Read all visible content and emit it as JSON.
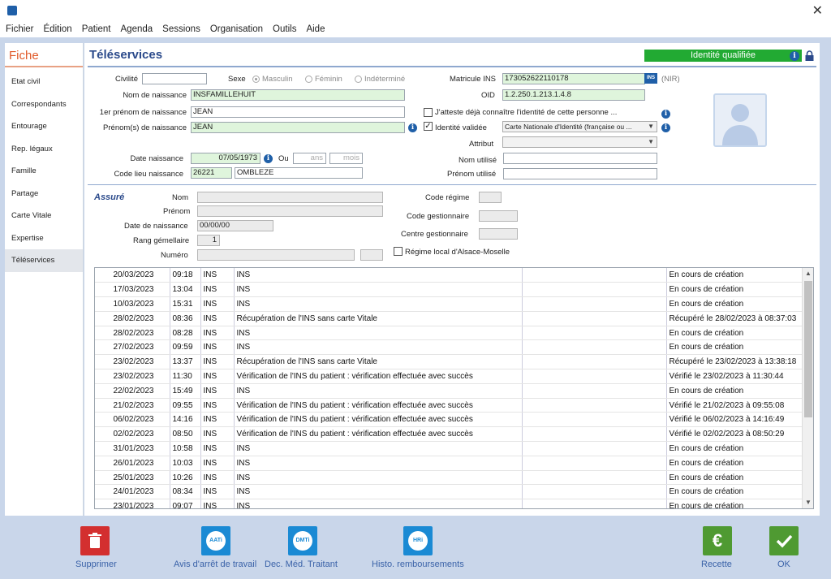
{
  "menu": [
    "Fichier",
    "Édition",
    "Patient",
    "Agenda",
    "Sessions",
    "Organisation",
    "Outils",
    "Aide"
  ],
  "sidebar": {
    "title": "Fiche",
    "items": [
      "Etat civil",
      "Correspondants",
      "Entourage",
      "Rep. légaux",
      "Famille",
      "Partage",
      "Carte Vitale",
      "Expertise",
      "Téléservices"
    ]
  },
  "header": {
    "title": "Téléservices",
    "badge": "Identité qualifiée",
    "info": "i"
  },
  "form": {
    "civilite_label": "Civilité",
    "sexe_label": "Sexe",
    "sexe_options": [
      "Masculin",
      "Féminin",
      "Indéterminé"
    ],
    "matricule_label": "Matricule INS",
    "matricule_value": "173052622110178",
    "ins_tag": "INS",
    "nir": "(NIR)",
    "nom_naissance_label": "Nom de naissance",
    "nom_naissance_value": "INSFAMILLEHUIT",
    "oid_label": "OID",
    "oid_value": "1.2.250.1.213.1.4.8",
    "premier_prenom_label": "1er prénom de naissance",
    "premier_prenom_value": "JEAN",
    "atteste_label": "J'atteste déjà connaître l'identité de cette personne ...",
    "prenoms_label": "Prénom(s) de naissance",
    "prenoms_value": "JEAN",
    "identite_validee_label": "Identité validée",
    "identite_doc": "Carte Nationale d'Identité (française ou ...",
    "attribut_label": "Attribut",
    "date_naissance_label": "Date naissance",
    "date_naissance_value": "07/05/1973",
    "ou": "Ou",
    "ans": "ans",
    "mois": "mois",
    "nom_utilise_label": "Nom utilisé",
    "code_lieu_label": "Code lieu naissance",
    "code_lieu_value": "26221",
    "commune_value": "OMBLEZE",
    "prenom_utilise_label": "Prénom utilisé"
  },
  "assure": {
    "title": "Assuré",
    "nom_label": "Nom",
    "prenom_label": "Prénom",
    "date_label": "Date de naissance",
    "date_value": "00/00/00",
    "rang_label": "Rang gémellaire",
    "rang_value": "1",
    "numero_label": "Numéro",
    "code_regime_label": "Code régime",
    "code_gestionnaire_label": "Code gestionnaire",
    "centre_gestionnaire_label": "Centre gestionnaire",
    "regime_local_label": "Régime local d'Alsace-Moselle"
  },
  "history": [
    [
      "20/03/2023",
      "09:18",
      "INS",
      "INS",
      "",
      "En cours de création"
    ],
    [
      "17/03/2023",
      "13:04",
      "INS",
      "INS",
      "",
      "En cours de création"
    ],
    [
      "10/03/2023",
      "15:31",
      "INS",
      "INS",
      "",
      "En cours de création"
    ],
    [
      "28/02/2023",
      "08:36",
      "INS",
      "Récupération de l'INS sans carte Vitale",
      "",
      "Récupéré le 28/02/2023 à 08:37:03"
    ],
    [
      "28/02/2023",
      "08:28",
      "INS",
      "INS",
      "",
      "En cours de création"
    ],
    [
      "27/02/2023",
      "09:59",
      "INS",
      "INS",
      "",
      "En cours de création"
    ],
    [
      "23/02/2023",
      "13:37",
      "INS",
      "Récupération de l'INS sans carte Vitale",
      "",
      "Récupéré le 23/02/2023 à 13:38:18"
    ],
    [
      "23/02/2023",
      "11:30",
      "INS",
      "Vérification de l'INS du patient : vérification effectuée avec succès",
      "",
      "Vérifié le 23/02/2023 à 11:30:44"
    ],
    [
      "22/02/2023",
      "15:49",
      "INS",
      "INS",
      "",
      "En cours de création"
    ],
    [
      "21/02/2023",
      "09:55",
      "INS",
      "Vérification de l'INS du patient : vérification effectuée avec succès",
      "",
      "Vérifié le 21/02/2023 à 09:55:08"
    ],
    [
      "06/02/2023",
      "14:16",
      "INS",
      "Vérification de l'INS du patient : vérification effectuée avec succès",
      "",
      "Vérifié le 06/02/2023 à 14:16:49"
    ],
    [
      "02/02/2023",
      "08:50",
      "INS",
      "Vérification de l'INS du patient : vérification effectuée avec succès",
      "",
      "Vérifié le 02/02/2023 à 08:50:29"
    ],
    [
      "31/01/2023",
      "10:58",
      "INS",
      "INS",
      "",
      "En cours de création"
    ],
    [
      "26/01/2023",
      "10:03",
      "INS",
      "INS",
      "",
      "En cours de création"
    ],
    [
      "25/01/2023",
      "10:26",
      "INS",
      "INS",
      "",
      "En cours de création"
    ],
    [
      "24/01/2023",
      "08:34",
      "INS",
      "INS",
      "",
      "En cours de création"
    ],
    [
      "23/01/2023",
      "09:07",
      "INS",
      "INS",
      "",
      "En cours de création"
    ]
  ],
  "actions": {
    "supprimer": "Supprimer",
    "aati": "Avis d'arrêt de travail",
    "aati_icon": "AATi",
    "dmti": "Dec. Méd. Traitant",
    "dmti_icon": "DMTi",
    "hri": "Histo. remboursements",
    "hri_icon": "HRi",
    "recette": "Recette",
    "recette_icon": "€",
    "ok": "OK"
  },
  "colors": {
    "accent": "#2b4a8b",
    "badge": "#22aa33",
    "delete": "#d32f2f",
    "service": "#1a8ad4",
    "confirm": "#4f9a32"
  }
}
